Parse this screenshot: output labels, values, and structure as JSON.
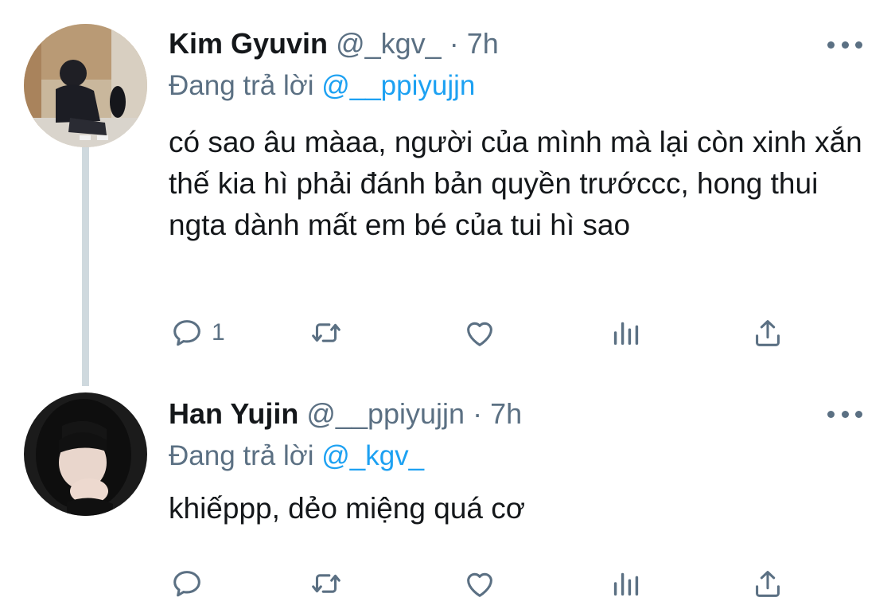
{
  "tweets": [
    {
      "name": "Kim Gyuvin",
      "handle": "@_kgv_",
      "separator": "·",
      "time": "7h",
      "reply_prefix": "Đang trả lời",
      "reply_to": "@__ppiyujjn",
      "text": "có sao âu màaa, người của mình mà lại còn xinh xắn thế kia hì phải đánh bản quyền trướccc, hong thui ngta dành mất em bé của tui hì sao",
      "reply_count": "1",
      "icons": [
        "reply-icon",
        "retweet-icon",
        "like-icon",
        "stats-icon",
        "share-icon",
        "more-icon"
      ]
    },
    {
      "name": "Han Yujin",
      "handle": "@__ppiyujjn",
      "separator": "·",
      "time": "7h",
      "reply_prefix": "Đang trả lời",
      "reply_to": "@_kgv_",
      "text": "khiếppp, dẻo miệng quá cơ",
      "reply_count": "",
      "icons": [
        "reply-icon",
        "retweet-icon",
        "like-icon",
        "stats-icon",
        "share-icon",
        "more-icon"
      ]
    }
  ],
  "colors": {
    "text": "#14171a",
    "secondary": "#5b7083",
    "link": "#1da1f2",
    "thread_line": "#cfd9de"
  }
}
